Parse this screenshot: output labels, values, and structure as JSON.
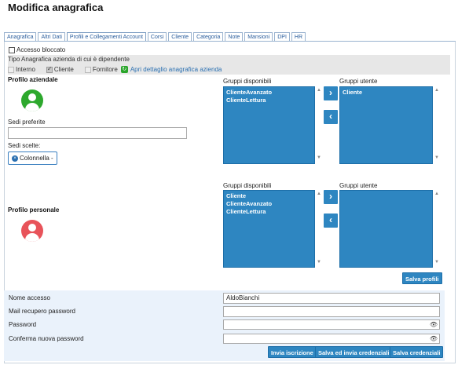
{
  "page_title": "Modifica anagrafica",
  "tabs": [
    "Anagrafica",
    "Altri Dati",
    "Profili e Collegamenti Account",
    "Corsi",
    "Cliente",
    "Categoria",
    "Note",
    "Mansioni",
    "DPI",
    "HR"
  ],
  "active_tab_index": 2,
  "accesso_bloccato": {
    "label": "Accesso bloccato",
    "checked": false
  },
  "tipo": {
    "label": "Tipo Anagrafica azienda di cui è dipendente",
    "interno": {
      "label": "Interno",
      "checked": false
    },
    "cliente": {
      "label": "Cliente",
      "checked": true
    },
    "fornitore": {
      "label": "Fornitore",
      "checked": false
    },
    "link": "Apri dettaglio anagrafica azienda"
  },
  "profilo_aziendale": {
    "label": "Profilo aziendale",
    "sedi_preferite_label": "Sedi preferite",
    "sedi_preferite_value": "",
    "sedi_scelte_label": "Sedi scelte:",
    "chip": "Colonnella -",
    "gruppi_disponibili_label": "Gruppi disponibili",
    "gruppi_utente_label": "Gruppi utente",
    "gruppi_disponibili": [
      "ClienteAvanzato",
      "ClienteLettura"
    ],
    "gruppi_utente": [
      "Cliente"
    ]
  },
  "profilo_personale": {
    "label": "Profilo personale",
    "gruppi_disponibili_label": "Gruppi disponibili",
    "gruppi_utente_label": "Gruppi utente",
    "gruppi_disponibili": [
      "Cliente",
      "ClienteAvanzato",
      "ClienteLettura"
    ],
    "gruppi_utente": []
  },
  "salva_profili": "Salva profili",
  "credenziali": {
    "nome_accesso_label": "Nome accesso",
    "nome_accesso_value": "AldoBianchi",
    "mail_label": "Mail recupero password",
    "mail_value": "",
    "password_label": "Password",
    "conferma_label": "Conferma nuova password"
  },
  "buttons": {
    "invia_iscrizione": "Invia iscrizione",
    "salva_invia": "Salva ed invia credenziali",
    "salva_credenziali": "Salva credenziali"
  },
  "colors": {
    "accent": "#2e86c1",
    "avatar_aziendale": "#2da82d",
    "avatar_personale": "#e8535a"
  }
}
